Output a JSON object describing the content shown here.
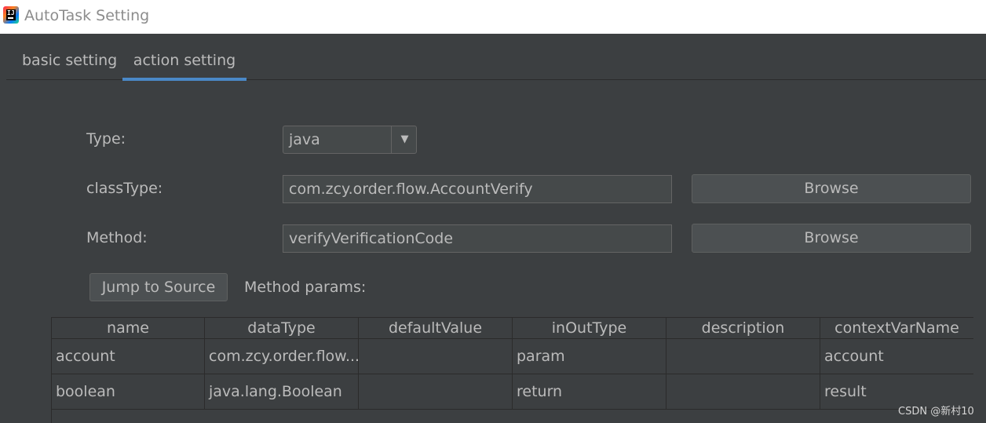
{
  "window": {
    "title": "AutoTask Setting"
  },
  "tabs": [
    {
      "label": "basic setting",
      "active": false
    },
    {
      "label": "action setting",
      "active": true
    }
  ],
  "form": {
    "type_label": "Type:",
    "type_value": "java",
    "classtype_label": "classType:",
    "classtype_value": "com.zcy.order.flow.AccountVerify",
    "method_label": "Method:",
    "method_value": "verifyVerificationCode",
    "browse_label": "Browse",
    "jump_label": "Jump to Source",
    "params_label": "Method params:"
  },
  "table": {
    "columns": [
      "name",
      "dataType",
      "defaultValue",
      "inOutType",
      "description",
      "contextVarName"
    ],
    "rows": [
      [
        "account",
        "com.zcy.order.flow....",
        "",
        "param",
        "",
        "account"
      ],
      [
        "boolean",
        "java.lang.Boolean",
        "",
        "return",
        "",
        "result"
      ]
    ]
  },
  "watermark": "CSDN @新村10",
  "colors": {
    "accent": "#4a88c7",
    "background": "#3c3f41",
    "text": "#bbbbbb"
  }
}
